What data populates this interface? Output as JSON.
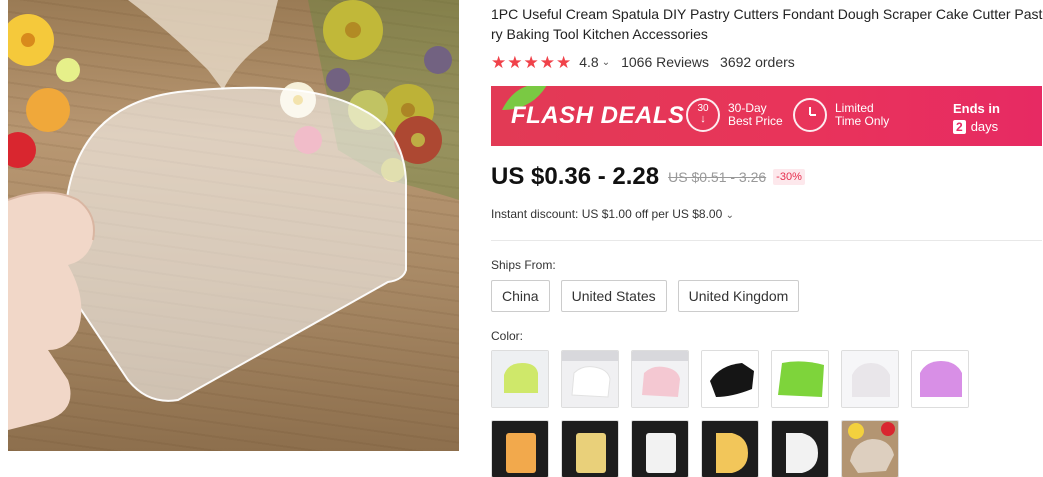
{
  "product": {
    "title": "1PC Useful Cream Spatula DIY Pastry Cutters Fondant Dough Scraper Cake Cutter Pastry Baking Tool Kitchen Accessories",
    "image_alt": "Clear plastic dough scraper held in hand"
  },
  "rating": {
    "score": "4.8",
    "reviews": "1066 Reviews",
    "orders": "3692 orders",
    "stars": 5
  },
  "flash": {
    "title": "FLASH DEALS",
    "feature1_num": "30",
    "feature1_line1": "30-Day",
    "feature1_line2": "Best Price",
    "feature2_line1": "Limited",
    "feature2_line2": "Time Only",
    "ends_label": "Ends in",
    "ends_days_num": "2",
    "ends_days_word": "days"
  },
  "price": {
    "current": "US $0.36 - 2.28",
    "original": "US $0.51 - 3.26",
    "discount_pct": "-30%"
  },
  "instant_discount": "Instant discount: US $1.00 off per US $8.00",
  "shipping": {
    "label": "Ships From:",
    "options": [
      "China",
      "United States",
      "United Kingdom"
    ]
  },
  "color": {
    "label": "Color:",
    "row1_icons": [
      "lime-scraper-icon",
      "white-scraper-icon",
      "pink-scraper-icon",
      "black-scraper-icon",
      "green-scraper-icon",
      "clear-white-scraper-icon",
      "purple-scraper-icon"
    ],
    "row2_icons": [
      "orange-scraper-icon",
      "yellow-scraper-icon",
      "white-rect-scraper-icon",
      "yellow-round-scraper-icon",
      "white-round-scraper-icon",
      "clear-scraper-photo-icon"
    ]
  },
  "colors": {
    "accent": "#e8345a",
    "star": "#f0424a",
    "discount": "#e62e4d"
  }
}
